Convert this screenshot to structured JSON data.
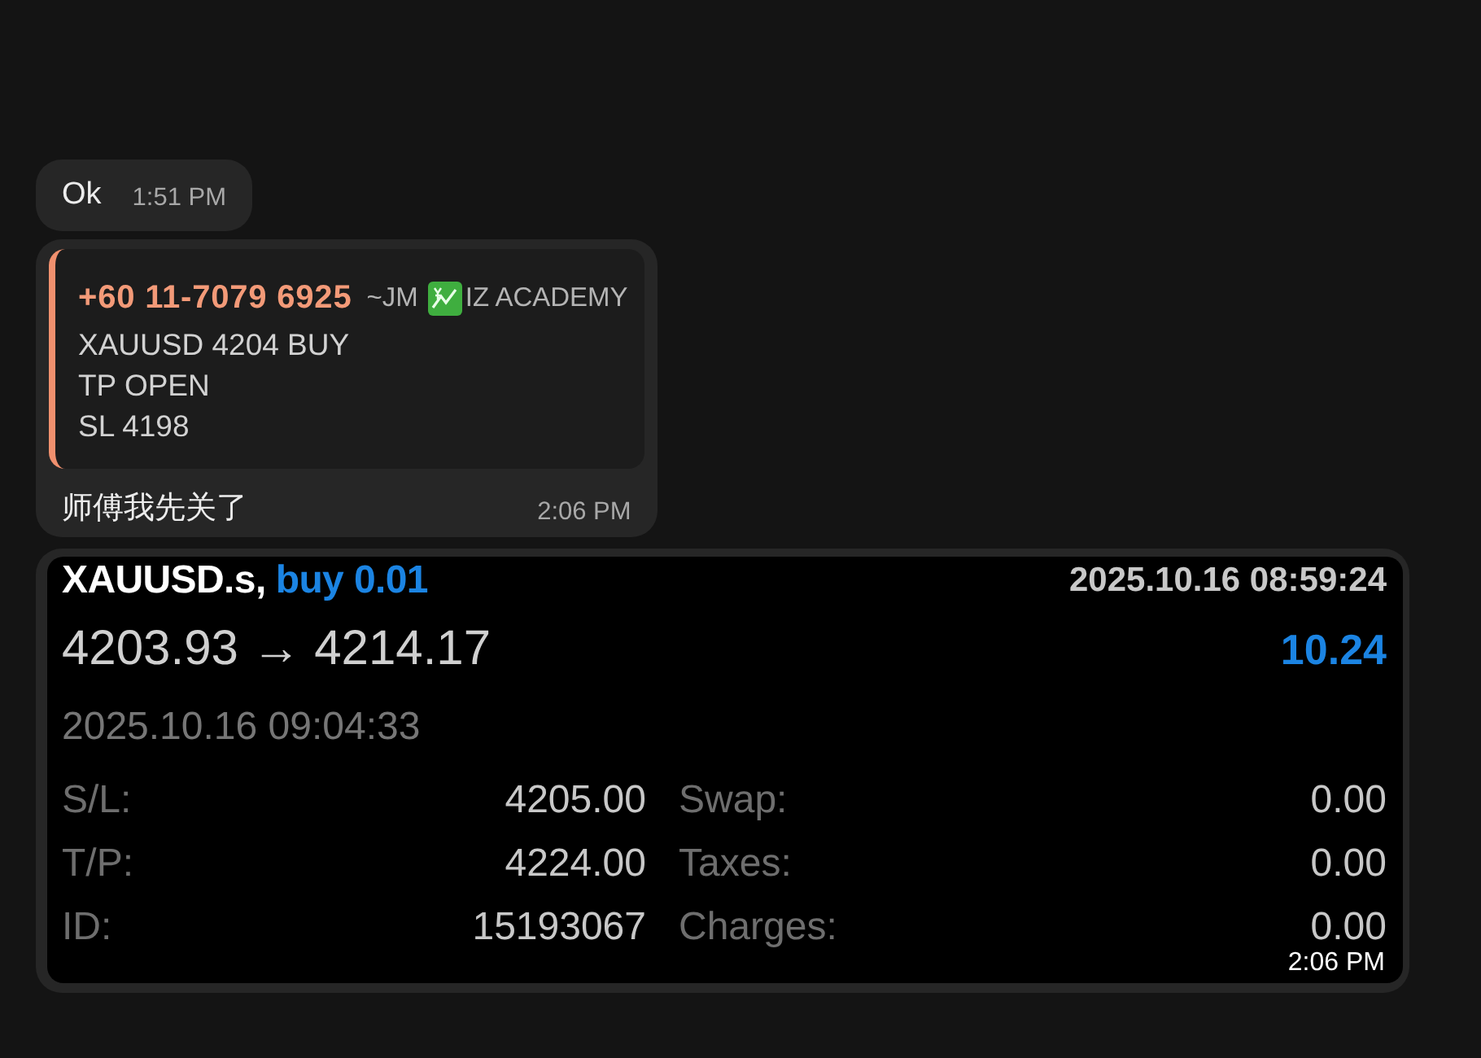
{
  "messages": [
    {
      "kind": "text",
      "text": "Ok",
      "time": "1:51 PM"
    },
    {
      "kind": "reply",
      "quote": {
        "sender_phone": "+60 11-7079 6925",
        "sender_name_before_icon": "~JM",
        "sender_name_after_icon": "IZ ACADEMY",
        "lines": [
          "XAUUSD 4204 BUY",
          "TP OPEN",
          "SL 4198"
        ]
      },
      "text": "师傅我先关了",
      "time": "2:06 PM"
    },
    {
      "kind": "trade_screenshot",
      "trade": {
        "symbol": "XAUUSD.s,",
        "order": "buy 0.01",
        "open_time": "2025.10.16 08:59:24",
        "prices": "4203.93 → 4214.17",
        "profit": "10.24",
        "close_time": "2025.10.16 09:04:33",
        "details": [
          {
            "label": "S/L:",
            "value": "4205.00"
          },
          {
            "label": "Swap:",
            "value": "0.00"
          },
          {
            "label": "T/P:",
            "value": "4224.00"
          },
          {
            "label": "Taxes:",
            "value": "0.00"
          },
          {
            "label": "ID:",
            "value": "15193067"
          },
          {
            "label": "Charges:",
            "value": "0.00"
          }
        ]
      },
      "time": "2:06 PM"
    }
  ]
}
